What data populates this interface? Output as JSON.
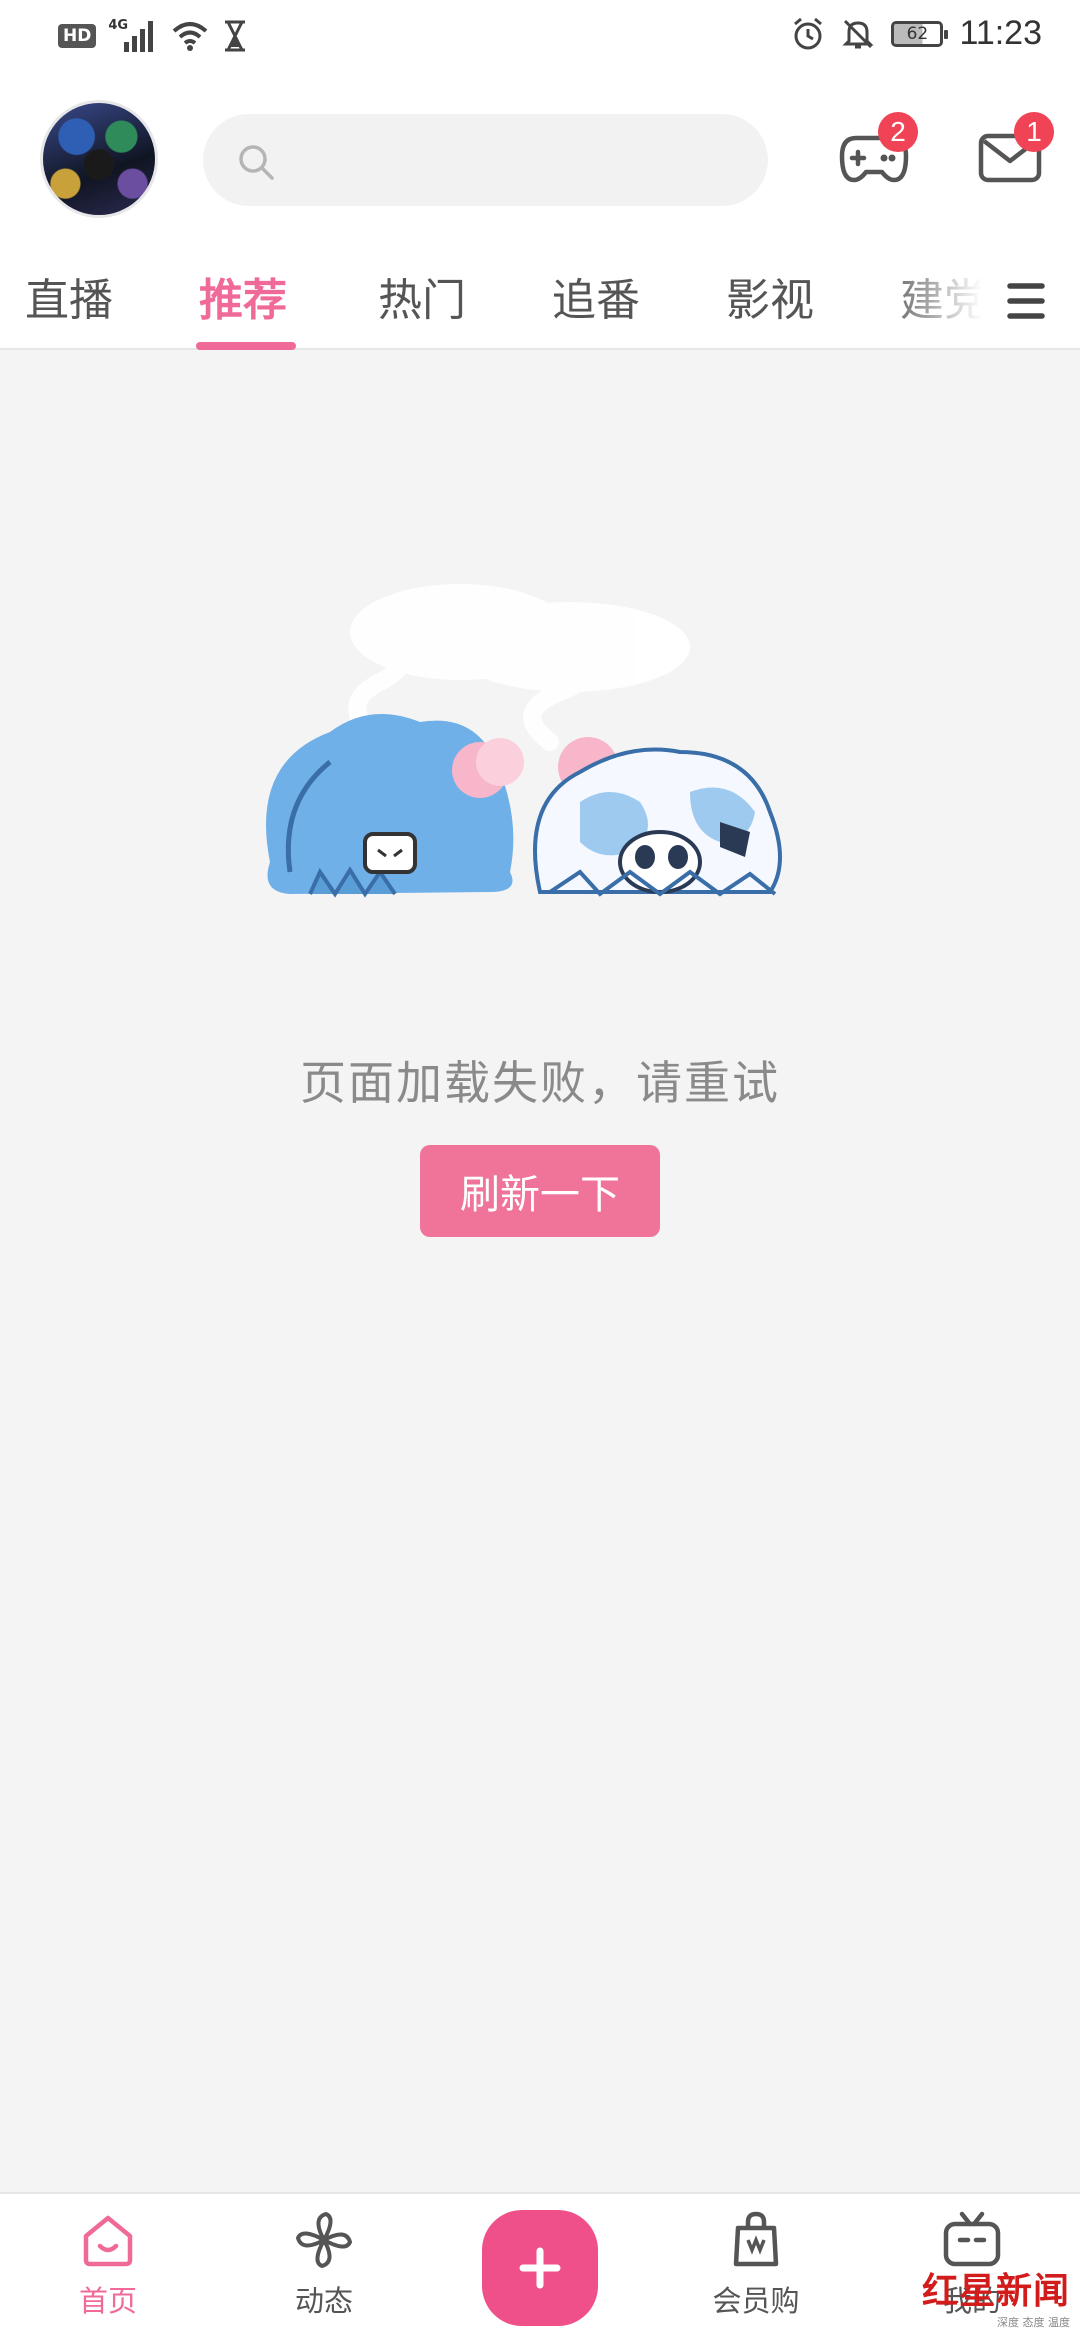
{
  "status_bar": {
    "hd": "HD",
    "network": "4G",
    "battery": "62",
    "time": "11:23",
    "icons": [
      "signal-icon",
      "wifi-icon",
      "hourglass-icon",
      "alarm-icon",
      "mute-icon",
      "battery-icon"
    ]
  },
  "header": {
    "avatar": "avatar",
    "search": {
      "placeholder": "",
      "value": ""
    },
    "game_badge": "2",
    "mail_badge": "1"
  },
  "tabs": [
    {
      "label": "直播"
    },
    {
      "label": "推荐",
      "active": true
    },
    {
      "label": "热门"
    },
    {
      "label": "追番"
    },
    {
      "label": "影视"
    },
    {
      "label": "建党"
    }
  ],
  "main": {
    "error_text": "页面加载失败，请重试",
    "refresh_label": "刷新一下"
  },
  "bottom_nav": {
    "items": [
      {
        "label": "首页",
        "icon": "home-icon",
        "active": true
      },
      {
        "label": "动态",
        "icon": "pinwheel-icon"
      },
      {
        "label": "",
        "icon": "plus-icon"
      },
      {
        "label": "会员购",
        "icon": "shopping-bag-icon"
      },
      {
        "label": "我的",
        "icon": "tv-icon"
      }
    ]
  },
  "watermark": {
    "text": "红星新闻",
    "sub": "深度 态度 温度"
  },
  "colors": {
    "accent": "#f06a99",
    "badge": "#f04356",
    "background": "#f4f4f4"
  }
}
